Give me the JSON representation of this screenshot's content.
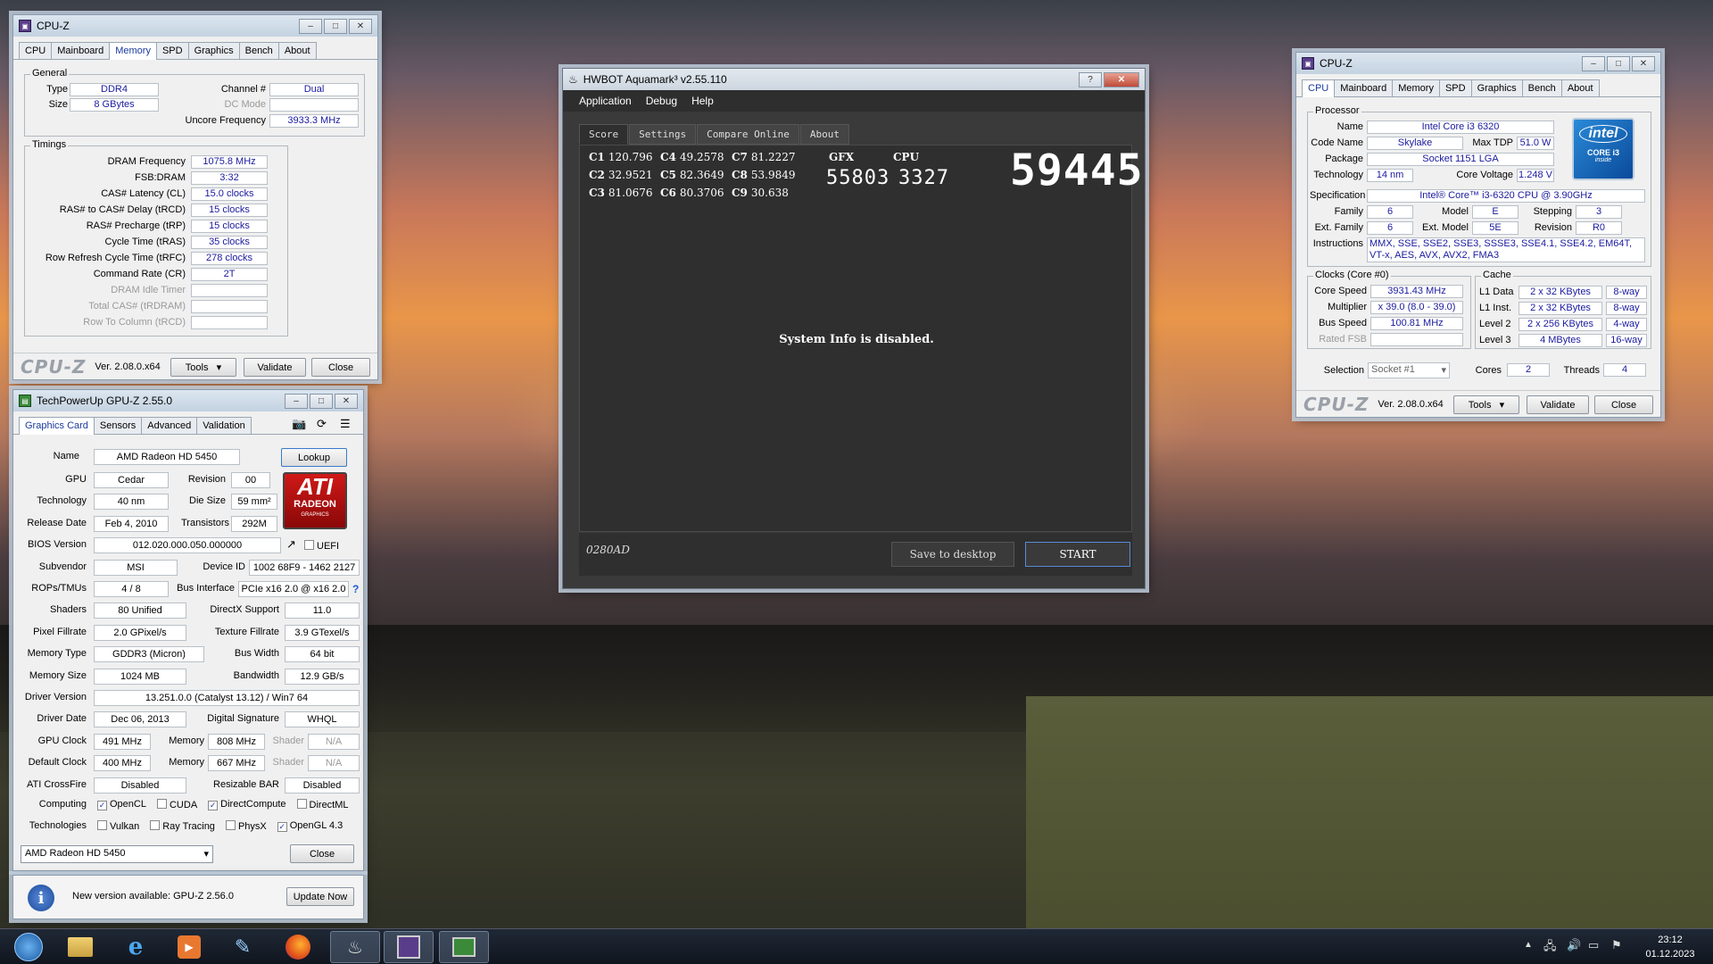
{
  "cpuz_mem": {
    "title": "CPU-Z",
    "tabs": [
      "CPU",
      "Mainboard",
      "Memory",
      "SPD",
      "Graphics",
      "Bench",
      "About"
    ],
    "active_tab": "Memory",
    "general_legend": "General",
    "type_label": "Type",
    "type": "DDR4",
    "size_label": "Size",
    "size": "8 GBytes",
    "channel_label": "Channel #",
    "channel": "Dual",
    "dcmode_label": "DC Mode",
    "dcmode": "",
    "uncore_label": "Uncore Frequency",
    "uncore": "3933.3 MHz",
    "timings_legend": "Timings",
    "timings": [
      {
        "label": "DRAM Frequency",
        "value": "1075.8 MHz",
        "dim": false
      },
      {
        "label": "FSB:DRAM",
        "value": "3:32",
        "dim": false
      },
      {
        "label": "CAS# Latency (CL)",
        "value": "15.0 clocks",
        "dim": false
      },
      {
        "label": "RAS# to CAS# Delay (tRCD)",
        "value": "15 clocks",
        "dim": false
      },
      {
        "label": "RAS# Precharge (tRP)",
        "value": "15 clocks",
        "dim": false
      },
      {
        "label": "Cycle Time (tRAS)",
        "value": "35 clocks",
        "dim": false
      },
      {
        "label": "Row Refresh Cycle Time (tRFC)",
        "value": "278 clocks",
        "dim": false
      },
      {
        "label": "Command Rate (CR)",
        "value": "2T",
        "dim": false
      },
      {
        "label": "DRAM Idle Timer",
        "value": "",
        "dim": true
      },
      {
        "label": "Total CAS# (tRDRAM)",
        "value": "",
        "dim": true
      },
      {
        "label": "Row To Column (tRCD)",
        "value": "",
        "dim": true
      }
    ],
    "brand": "CPU-Z",
    "version": "Ver. 2.08.0.x64",
    "tools": "Tools",
    "validate": "Validate",
    "close": "Close"
  },
  "gpuz": {
    "title": "TechPowerUp GPU-Z 2.55.0",
    "tabs": [
      "Graphics Card",
      "Sensors",
      "Advanced",
      "Validation"
    ],
    "lookup": "Lookup",
    "logo_text": "ATI",
    "logo_sub": "RADEON",
    "logo_sub2": "GRAPHICS",
    "name_label": "Name",
    "name": "AMD Radeon HD 5450",
    "gpu_label": "GPU",
    "gpu": "Cedar",
    "revision_label": "Revision",
    "revision": "00",
    "tech_label": "Technology",
    "tech": "40 nm",
    "die_label": "Die Size",
    "die": "59 mm²",
    "release_label": "Release Date",
    "release": "Feb 4, 2010",
    "trans_label": "Transistors",
    "trans": "292M",
    "bios_label": "BIOS Version",
    "bios": "012.020.000.050.000000",
    "uefi": "UEFI",
    "subvendor_label": "Subvendor",
    "subvendor": "MSI",
    "devid_label": "Device ID",
    "devid": "1002 68F9 - 1462 2127",
    "rops_label": "ROPs/TMUs",
    "rops": "4 / 8",
    "bus_label": "Bus Interface",
    "bus": "PCIe x16 2.0 @ x16 2.0",
    "bus_help": "?",
    "shaders_label": "Shaders",
    "shaders": "80 Unified",
    "dx_label": "DirectX Support",
    "dx": "11.0",
    "pixel_label": "Pixel Fillrate",
    "pixel": "2.0 GPixel/s",
    "tex_label": "Texture Fillrate",
    "tex": "3.9 GTexel/s",
    "memtype_label": "Memory Type",
    "memtype": "GDDR3 (Micron)",
    "buswidth_label": "Bus Width",
    "buswidth": "64 bit",
    "memsize_label": "Memory Size",
    "memsize": "1024 MB",
    "bandwidth_label": "Bandwidth",
    "bandwidth": "12.9 GB/s",
    "driver_label": "Driver Version",
    "driver": "13.251.0.0 (Catalyst 13.12) / Win7 64",
    "drvdate_label": "Driver Date",
    "drvdate": "Dec 06, 2013",
    "digsig_label": "Digital Signature",
    "digsig": "WHQL",
    "gpuclock_label": "GPU Clock",
    "gpuclock": "491 MHz",
    "mem_label": "Memory",
    "memclock": "808 MHz",
    "shader_label": "Shader",
    "shader": "N/A",
    "defclock_label": "Default Clock",
    "defclock": "400 MHz",
    "defmem": "667 MHz",
    "defshader": "N/A",
    "crossfire_label": "ATI CrossFire",
    "crossfire": "Disabled",
    "rebar_label": "Resizable BAR",
    "rebar": "Disabled",
    "computing_label": "Computing",
    "computing": [
      {
        "label": "OpenCL",
        "checked": true
      },
      {
        "label": "CUDA",
        "checked": false
      },
      {
        "label": "DirectCompute",
        "checked": true
      },
      {
        "label": "DirectML",
        "checked": false
      }
    ],
    "technologies_label": "Technologies",
    "technologies": [
      {
        "label": "Vulkan",
        "checked": false
      },
      {
        "label": "Ray Tracing",
        "checked": false
      },
      {
        "label": "PhysX",
        "checked": false
      },
      {
        "label": "OpenGL 4.3",
        "checked": true
      }
    ],
    "select": "AMD Radeon HD 5450",
    "close": "Close",
    "update_text": "New version available: GPU-Z 2.56.0",
    "update_btn": "Update Now"
  },
  "hwbot": {
    "title": "HWBOT Aquamark³ v2.55.110",
    "menu": [
      "Application",
      "Debug",
      "Help"
    ],
    "tabs": [
      "Score",
      "Settings",
      "Compare Online",
      "About"
    ],
    "scores": [
      {
        "k": "C1",
        "v": "120.796"
      },
      {
        "k": "C2",
        "v": "32.9521"
      },
      {
        "k": "C3",
        "v": "81.0676"
      },
      {
        "k": "C4",
        "v": "49.2578"
      },
      {
        "k": "C5",
        "v": "82.3649"
      },
      {
        "k": "C6",
        "v": "80.3706"
      },
      {
        "k": "C7",
        "v": "81.2227"
      },
      {
        "k": "C8",
        "v": "53.9849"
      },
      {
        "k": "C9",
        "v": "30.638"
      }
    ],
    "gfx_label": "GFX",
    "gfx": "55803",
    "cpu_label": "CPU",
    "cpu": "3327",
    "total": "59445",
    "sysinfo": "System Info is disabled.",
    "code": "0280AD",
    "save": "Save to desktop",
    "start": "START"
  },
  "cpuz_cpu": {
    "title": "CPU-Z",
    "tabs": [
      "CPU",
      "Mainboard",
      "Memory",
      "SPD",
      "Graphics",
      "Bench",
      "About"
    ],
    "active_tab": "CPU",
    "processor_legend": "Processor",
    "name_label": "Name",
    "name": "Intel Core i3 6320",
    "codename_label": "Code Name",
    "codename": "Skylake",
    "maxtdp_label": "Max TDP",
    "maxtdp": "51.0 W",
    "package_label": "Package",
    "package": "Socket 1151 LGA",
    "tech_label": "Technology",
    "tech": "14 nm",
    "voltage_label": "Core Voltage",
    "voltage": "1.248 V",
    "spec_label": "Specification",
    "spec": "Intel® Core™ i3-6320 CPU @ 3.90GHz",
    "family_label": "Family",
    "family": "6",
    "model_label": "Model",
    "model": "E",
    "stepping_label": "Stepping",
    "stepping": "3",
    "extfam_label": "Ext. Family",
    "extfam": "6",
    "extmodel_label": "Ext. Model",
    "extmodel": "5E",
    "rev_label": "Revision",
    "rev": "R0",
    "instr_label": "Instructions",
    "instr": "MMX, SSE, SSE2, SSE3, SSSE3, SSE4.1, SSE4.2, EM64T, VT-x, AES, AVX, AVX2, FMA3",
    "clocks_legend": "Clocks (Core #0)",
    "corespeed_label": "Core Speed",
    "corespeed": "3931.43 MHz",
    "mult_label": "Multiplier",
    "mult": "x 39.0 (8.0 - 39.0)",
    "bus_label": "Bus Speed",
    "bus": "100.81 MHz",
    "fsb_label": "Rated FSB",
    "fsb": "",
    "cache_legend": "Cache",
    "cache": [
      {
        "label": "L1 Data",
        "size": "2 x 32 KBytes",
        "way": "8-way"
      },
      {
        "label": "L1 Inst.",
        "size": "2 x 32 KBytes",
        "way": "8-way"
      },
      {
        "label": "Level 2",
        "size": "2 x 256 KBytes",
        "way": "4-way"
      },
      {
        "label": "Level 3",
        "size": "4 MBytes",
        "way": "16-way"
      }
    ],
    "sel_label": "Selection",
    "sel": "Socket #1",
    "cores_label": "Cores",
    "cores": "2",
    "threads_label": "Threads",
    "threads": "4",
    "intel_logo": "intel",
    "intel_core": "CORE i3",
    "intel_inside": "inside",
    "brand": "CPU-Z",
    "version": "Ver. 2.08.0.x64",
    "tools": "Tools",
    "validate": "Validate",
    "close": "Close"
  },
  "taskbar": {
    "time": "23:12",
    "date": "01.12.2023"
  }
}
